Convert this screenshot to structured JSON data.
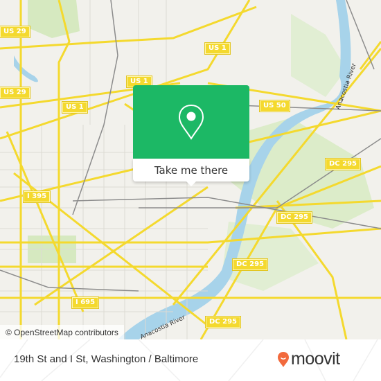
{
  "map": {
    "shields": [
      {
        "label": "US 29",
        "id": "shield-us29-a"
      },
      {
        "label": "US 29",
        "id": "shield-us29-b"
      },
      {
        "label": "US 1",
        "id": "shield-us1-a"
      },
      {
        "label": "US 1",
        "id": "shield-us1-b"
      },
      {
        "label": "US 1",
        "id": "shield-us1-c"
      },
      {
        "label": "US 50",
        "id": "shield-us50"
      },
      {
        "label": "I 395",
        "id": "shield-i395"
      },
      {
        "label": "I 695",
        "id": "shield-i695"
      },
      {
        "label": "DC 295",
        "id": "shield-dc295-a"
      },
      {
        "label": "DC 295",
        "id": "shield-dc295-b"
      },
      {
        "label": "DC 295",
        "id": "shield-dc295-c"
      },
      {
        "label": "DC 295",
        "id": "shield-dc295-d"
      }
    ],
    "river_labels": [
      "Anacostia River",
      "Anacostia River"
    ],
    "attribution": "© OpenStreetMap contributors"
  },
  "popup": {
    "action_label": "Take me there",
    "icon": "location-pin-icon"
  },
  "footer": {
    "location_title": "19th St and I St, Washington / Baltimore",
    "brand": "moovit",
    "brand_color": "#f26a3d"
  },
  "colors": {
    "popup_green": "#1cb865",
    "road_yellow": "#f4d92e",
    "water": "#a7d3ea",
    "park": "#d6e9c0"
  }
}
